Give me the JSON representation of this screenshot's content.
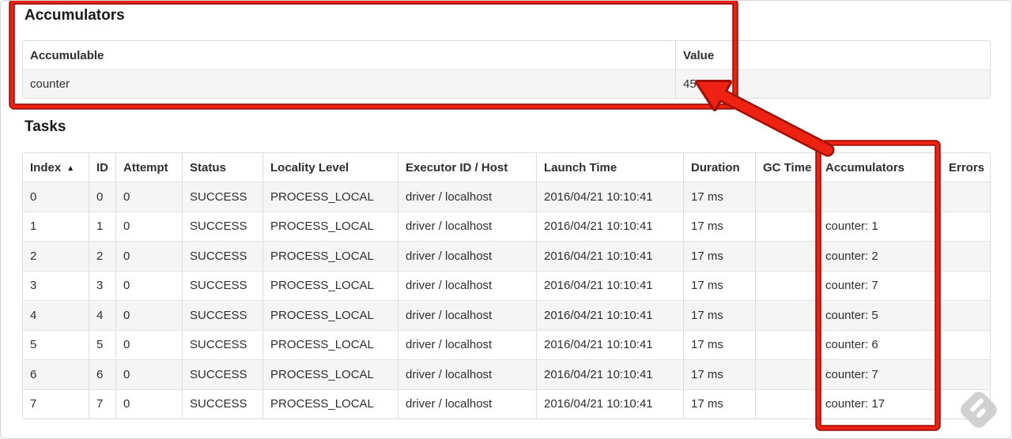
{
  "accumulators_section": {
    "title": "Accumulators",
    "table": {
      "headers": [
        "Accumulable",
        "Value"
      ],
      "row": {
        "name": "counter",
        "value": "45"
      }
    }
  },
  "tasks_section": {
    "title": "Tasks",
    "table": {
      "headers": [
        "Index",
        "ID",
        "Attempt",
        "Status",
        "Locality Level",
        "Executor ID / Host",
        "Launch Time",
        "Duration",
        "GC Time",
        "Accumulators",
        "Errors"
      ],
      "sort_indicator": "▲",
      "rows": [
        {
          "index": "0",
          "id": "0",
          "attempt": "0",
          "status": "SUCCESS",
          "locality": "PROCESS_LOCAL",
          "executor": "driver / localhost",
          "launch": "2016/04/21 10:10:41",
          "duration": "17 ms",
          "gc": "",
          "accumulators": "",
          "errors": ""
        },
        {
          "index": "1",
          "id": "1",
          "attempt": "0",
          "status": "SUCCESS",
          "locality": "PROCESS_LOCAL",
          "executor": "driver / localhost",
          "launch": "2016/04/21 10:10:41",
          "duration": "17 ms",
          "gc": "",
          "accumulators": "counter: 1",
          "errors": ""
        },
        {
          "index": "2",
          "id": "2",
          "attempt": "0",
          "status": "SUCCESS",
          "locality": "PROCESS_LOCAL",
          "executor": "driver / localhost",
          "launch": "2016/04/21 10:10:41",
          "duration": "17 ms",
          "gc": "",
          "accumulators": "counter: 2",
          "errors": ""
        },
        {
          "index": "3",
          "id": "3",
          "attempt": "0",
          "status": "SUCCESS",
          "locality": "PROCESS_LOCAL",
          "executor": "driver / localhost",
          "launch": "2016/04/21 10:10:41",
          "duration": "17 ms",
          "gc": "",
          "accumulators": "counter: 7",
          "errors": ""
        },
        {
          "index": "4",
          "id": "4",
          "attempt": "0",
          "status": "SUCCESS",
          "locality": "PROCESS_LOCAL",
          "executor": "driver / localhost",
          "launch": "2016/04/21 10:10:41",
          "duration": "17 ms",
          "gc": "",
          "accumulators": "counter: 5",
          "errors": ""
        },
        {
          "index": "5",
          "id": "5",
          "attempt": "0",
          "status": "SUCCESS",
          "locality": "PROCESS_LOCAL",
          "executor": "driver / localhost",
          "launch": "2016/04/21 10:10:41",
          "duration": "17 ms",
          "gc": "",
          "accumulators": "counter: 6",
          "errors": ""
        },
        {
          "index": "6",
          "id": "6",
          "attempt": "0",
          "status": "SUCCESS",
          "locality": "PROCESS_LOCAL",
          "executor": "driver / localhost",
          "launch": "2016/04/21 10:10:41",
          "duration": "17 ms",
          "gc": "",
          "accumulators": "counter: 7",
          "errors": ""
        },
        {
          "index": "7",
          "id": "7",
          "attempt": "0",
          "status": "SUCCESS",
          "locality": "PROCESS_LOCAL",
          "executor": "driver / localhost",
          "launch": "2016/04/21 10:10:41",
          "duration": "17 ms",
          "gc": "",
          "accumulators": "counter: 17",
          "errors": ""
        }
      ]
    }
  },
  "annotations": {
    "red_bright": "#ee2213",
    "red_dark": "#9e0f05",
    "highlight_1": "accumulators-summary-box",
    "highlight_2": "accumulators-column-box",
    "arrow_target": "value-45"
  }
}
